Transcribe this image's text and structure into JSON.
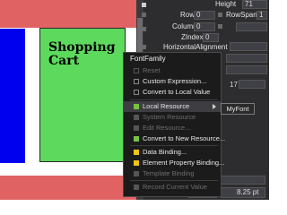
{
  "design_surface": {
    "heading": "Shopping\nCart"
  },
  "properties": {
    "height_label": "Height",
    "height_value": "71",
    "row_label": "Row",
    "row_value": "0",
    "rowspan_label": "RowSpan",
    "rowspan_value": "1",
    "column_label": "Column",
    "column_value": "0",
    "zindex_label": "ZIndex",
    "zindex_value": "0",
    "horizontal_alignment_label": "HorizontalAlignment",
    "size_value_1": "17",
    "font_size_value": "8.25 pt"
  },
  "context_menu": {
    "title": "FontFamily",
    "items": [
      {
        "label": "Reset",
        "enabled": false,
        "icon": "checkbox"
      },
      {
        "label": "Custom Expression...",
        "enabled": true,
        "icon": "checkbox"
      },
      {
        "label": "Convert to Local Value",
        "enabled": true,
        "icon": "checkbox"
      },
      {
        "label": "Local Resource",
        "enabled": true,
        "icon": "green-square",
        "highlight": true
      },
      {
        "label": "System Resource",
        "enabled": false,
        "icon": "gray-square"
      },
      {
        "label": "Edit Resource...",
        "enabled": false,
        "icon": "gray-square"
      },
      {
        "label": "Convert to New Resource...",
        "enabled": true,
        "icon": "green-square"
      },
      {
        "label": "Data Binding...",
        "enabled": true,
        "icon": "yellow-square"
      },
      {
        "label": "Element Property Binding...",
        "enabled": true,
        "icon": "yellow-square"
      },
      {
        "label": "Template Binding",
        "enabled": false,
        "icon": "gray-square"
      },
      {
        "label": "Record Current Value",
        "enabled": false,
        "icon": "gray-square"
      }
    ],
    "submenu_item": "MyFont"
  },
  "colors": {
    "green_block": "#5dd95d",
    "blue_block": "#0000ee",
    "red_band": "#e06262",
    "panel_bg": "#2d2d30",
    "menu_bg": "#1b1b1c"
  }
}
